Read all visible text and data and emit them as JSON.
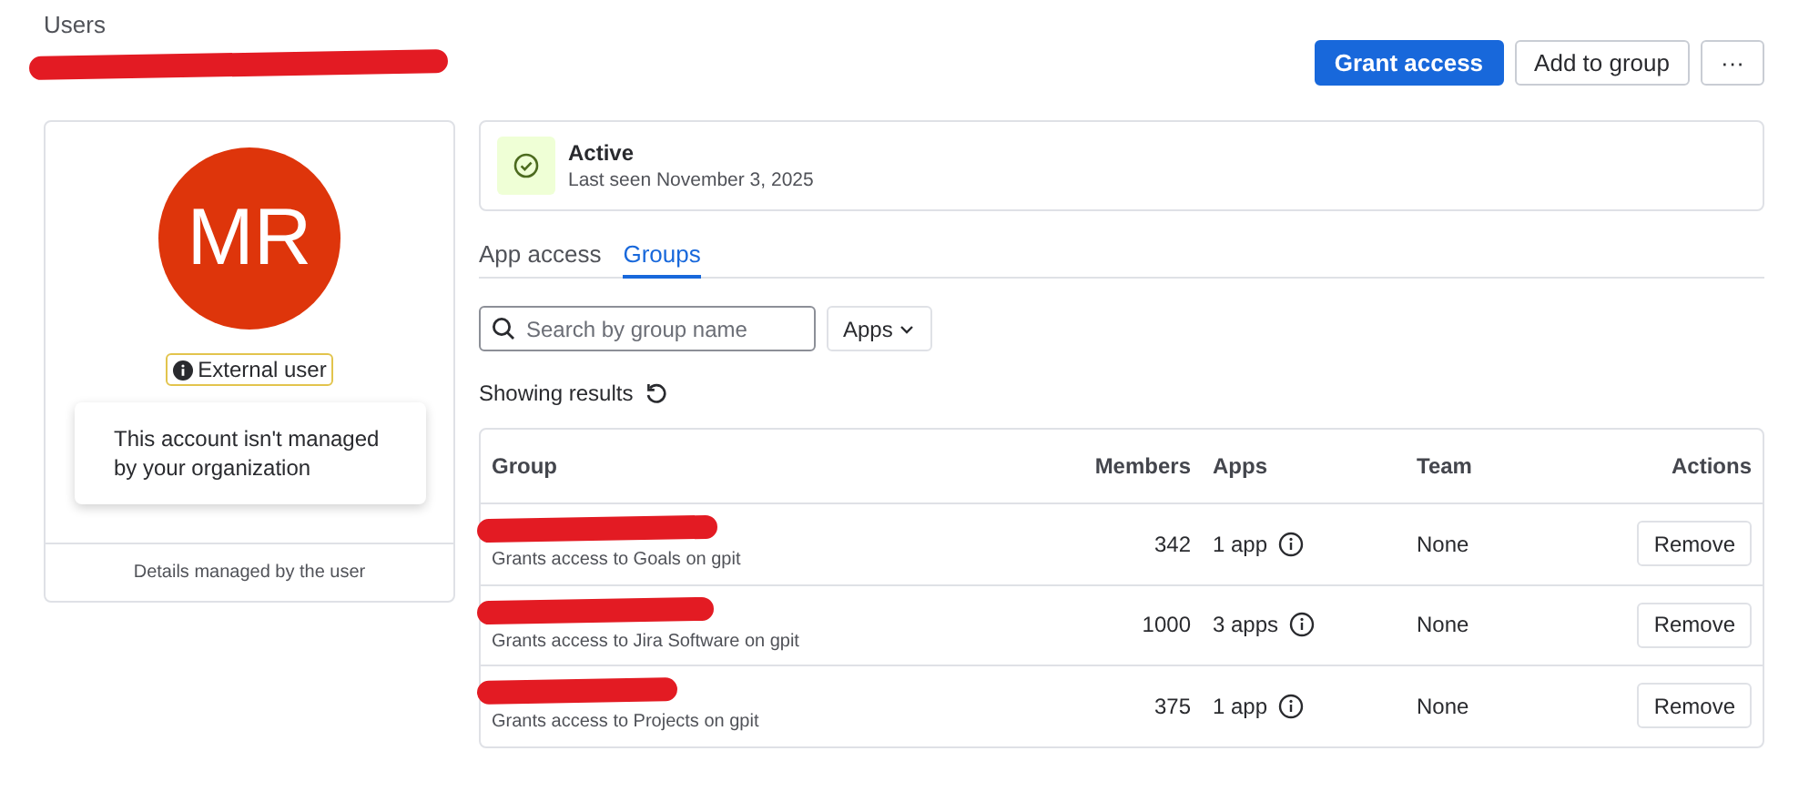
{
  "breadcrumb": "Users",
  "user": {
    "name_redacted": true,
    "initials": "MR",
    "badge": "External user",
    "notice": "This account isn't managed by your organization",
    "footer": "Details managed by the user"
  },
  "actions": {
    "primary": "Grant access",
    "secondary": "Add to group",
    "more": "···"
  },
  "status": {
    "title": "Active",
    "subtitle": "Last seen November 3, 2025"
  },
  "tabs": [
    {
      "label": "App access",
      "selected": false
    },
    {
      "label": "Groups",
      "selected": true
    }
  ],
  "search": {
    "placeholder": "Search by group name"
  },
  "filter": {
    "label": "Apps"
  },
  "results_label": "Showing results",
  "table": {
    "columns": [
      "Group",
      "Members",
      "Apps",
      "Team",
      "Actions"
    ],
    "rows": [
      {
        "name_redacted": true,
        "description": "Grants access to Goals on gpit",
        "members": "342",
        "apps": "1 app",
        "team": "None",
        "action": "Remove"
      },
      {
        "name_redacted": true,
        "description": "Grants access to Jira Software on gpit",
        "members": "1000",
        "apps": "3 apps",
        "team": "None",
        "action": "Remove"
      },
      {
        "name_redacted": true,
        "description": "Grants access to Projects on gpit",
        "members": "375",
        "apps": "1 app",
        "team": "None",
        "action": "Remove"
      }
    ]
  }
}
